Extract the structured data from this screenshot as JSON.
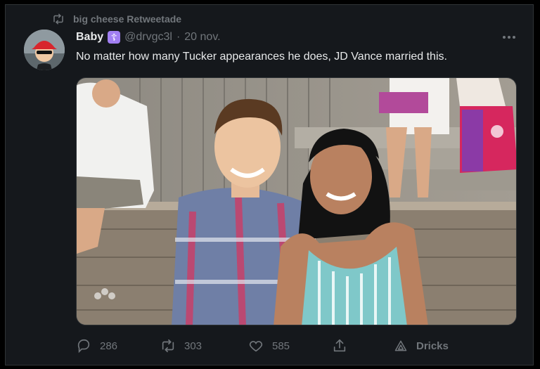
{
  "retweet_banner": {
    "text": "big cheese Retweetade",
    "icon": "retweet-icon"
  },
  "author": {
    "name": "Baby",
    "badge_glyph": "☦",
    "badge_color": "#a17ff2",
    "handle": "@drvgc3l",
    "separator": "·",
    "date": "20 nov."
  },
  "tweet": {
    "text": "No matter how many Tucker appearances he does, JD Vance married this."
  },
  "actions": {
    "reply": {
      "icon": "reply-icon",
      "count": "286"
    },
    "retweet": {
      "icon": "retweet-icon",
      "count": "303"
    },
    "like": {
      "icon": "heart-icon",
      "count": "585"
    },
    "share": {
      "icon": "share-icon"
    },
    "analytics": {
      "icon": "analytics-icon",
      "label": "Dricks"
    }
  },
  "colors": {
    "background": "#000000",
    "card": "#15181c",
    "text": "#e7e9ea",
    "muted": "#71767b"
  }
}
